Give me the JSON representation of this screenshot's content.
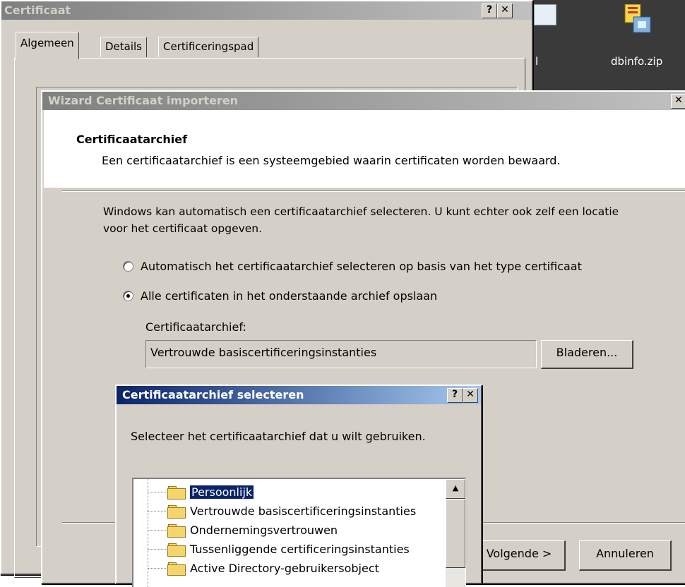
{
  "desktop": {
    "zip_label": "dbinfo.zip",
    "pipe_label": "l"
  },
  "cert_window": {
    "title": "Certificaat",
    "help_btn": "?",
    "close_btn": "✕",
    "tabs": [
      {
        "label": "Algemeen"
      },
      {
        "label": "Details"
      },
      {
        "label": "Certificeringspad"
      }
    ]
  },
  "wizard": {
    "title": "Wizard Certificaat importeren",
    "close_btn": "✕",
    "heading": "Certificaatarchief",
    "subheading": "Een certificaatarchief is een systeemgebied waarin certificaten worden bewaard.",
    "description": "Windows kan automatisch een certificaatarchief selecteren. U kunt echter ook zelf een locatie voor het certificaat opgeven.",
    "radio_auto": "Automatisch het certificaatarchief selecteren op basis van het type certificaat",
    "radio_manual": "Alle certificaten in het onderstaande archief opslaan",
    "store_label": "Certificaatarchief:",
    "store_value": "Vertrouwde basiscertificeringsinstanties",
    "browse_button": "Bladeren...",
    "next_button": "Volgende >",
    "cancel_button": "Annuleren"
  },
  "select_dialog": {
    "title": "Certificaatarchief selecteren",
    "help_btn": "?",
    "close_btn": "✕",
    "prompt": "Selecteer het certificaatarchief dat u wilt gebruiken.",
    "items": [
      {
        "label": "Persoonlijk"
      },
      {
        "label": "Vertrouwde basiscertificeringsinstanties"
      },
      {
        "label": "Ondernemingsvertrouwen"
      },
      {
        "label": "Tussenliggende certificeringsinstanties"
      },
      {
        "label": "Active Directory-gebruikersobject"
      }
    ],
    "scroll_up": "▲"
  }
}
